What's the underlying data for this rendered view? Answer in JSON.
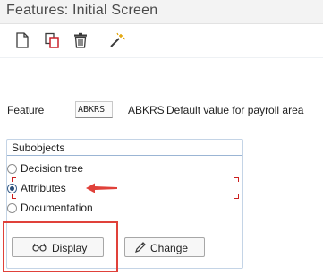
{
  "window": {
    "title": "Features: Initial Screen"
  },
  "toolbar": {
    "items": [
      {
        "name": "create",
        "icon": "new-document-icon"
      },
      {
        "name": "copy",
        "icon": "copy-icon"
      },
      {
        "name": "delete",
        "icon": "trash-icon"
      },
      {
        "name": "wizard",
        "icon": "magic-wand-icon"
      }
    ]
  },
  "feature": {
    "label": "Feature",
    "value": "ABKRS",
    "key": "ABKRS",
    "description": "Default value for payroll area"
  },
  "subobjects": {
    "title": "Subobjects",
    "options": [
      {
        "label": "Decision tree",
        "selected": false
      },
      {
        "label": "Attributes",
        "selected": true
      },
      {
        "label": "Documentation",
        "selected": false
      }
    ]
  },
  "actions": {
    "display_label": "Display",
    "change_label": "Change"
  },
  "colors": {
    "annotation_red": "#e0413a",
    "radio_selected": "#2b4f7a",
    "group_border": "#9bb5d4"
  }
}
